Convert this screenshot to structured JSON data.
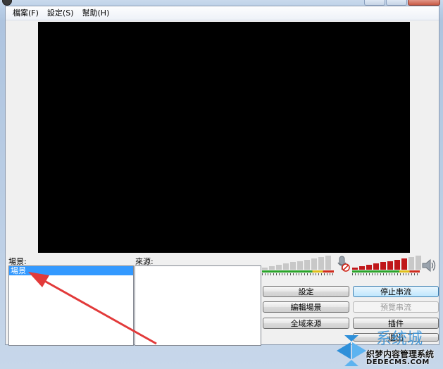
{
  "menu": {
    "items": [
      "檔案(F)",
      "設定(S)",
      "幫助(H)"
    ]
  },
  "scenes": {
    "label": "場景:",
    "items": [
      "場景"
    ]
  },
  "sources": {
    "label": "來源:"
  },
  "buttons": {
    "settings": "設定",
    "stop_stream": "停止串流",
    "edit_scene": "編輯場景",
    "preview_stream": "預覽串流",
    "global_sources": "全域來源",
    "plugins": "插件",
    "exit": "退出"
  },
  "watermark": {
    "line1": "织梦内容管理系统",
    "line2": "DEDECMS.COM"
  },
  "colors": {
    "selection": "#3399ff",
    "annotation_arrow": "#e23a3a",
    "meter_active": "#c0171a",
    "meter_idle": "#c8c8c8"
  }
}
